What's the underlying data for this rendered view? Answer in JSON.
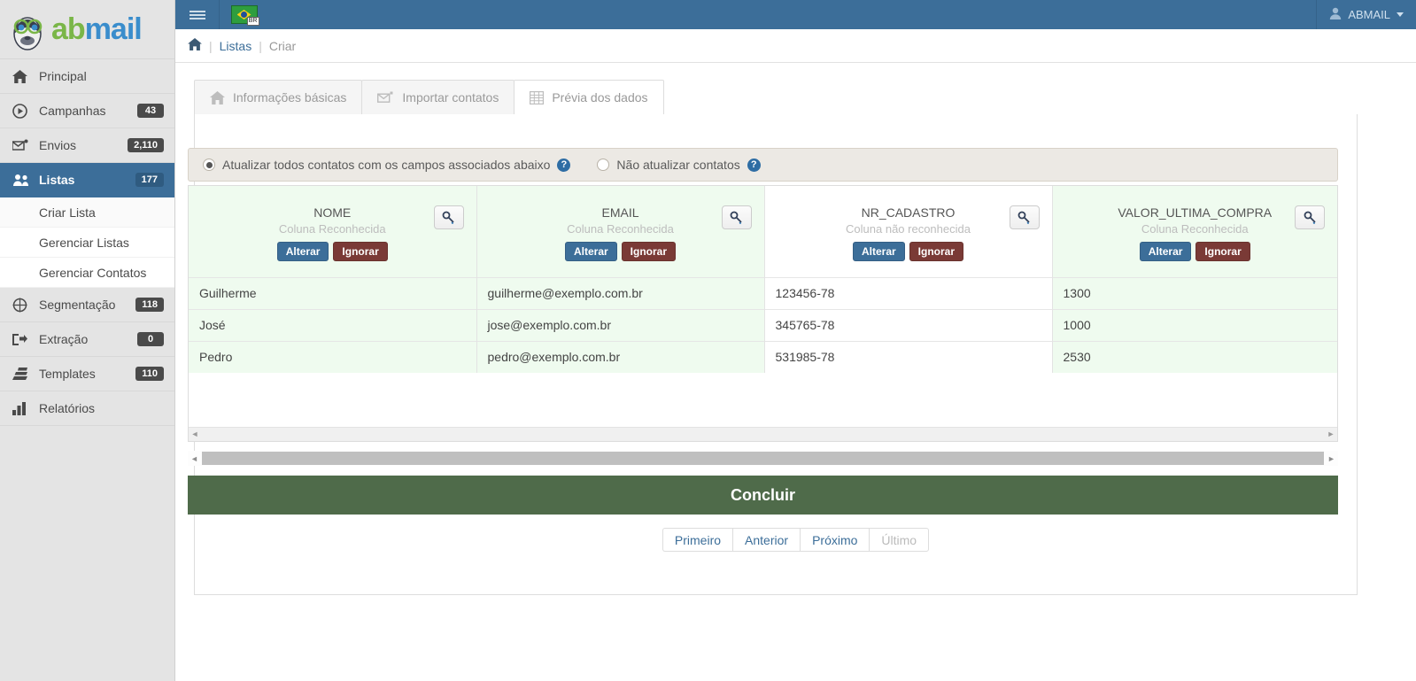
{
  "brand": {
    "name_part1": "ab",
    "name_part2": "mail",
    "color_green": "#7ab648",
    "color_blue": "#3a8dcc"
  },
  "topbar": {
    "menu_toggle": "hamburger-menu",
    "language": "BR",
    "user_label": "ABMAIL"
  },
  "breadcrumb": {
    "home": "home-icon",
    "items": [
      {
        "label": "Listas",
        "current": false
      },
      {
        "label": "Criar",
        "current": true
      }
    ]
  },
  "sidebar": {
    "items": [
      {
        "label": "Principal",
        "badge": "",
        "icon": "home-icon",
        "active": false
      },
      {
        "label": "Campanhas",
        "badge": "43",
        "icon": "play-circle-icon",
        "active": false
      },
      {
        "label": "Envios",
        "badge": "2,110",
        "icon": "envelope-send-icon",
        "active": false
      },
      {
        "label": "Listas",
        "badge": "177",
        "icon": "users-icon",
        "active": true
      },
      {
        "label": "Segmentação",
        "badge": "118",
        "icon": "target-icon",
        "active": false
      },
      {
        "label": "Extração",
        "badge": "0",
        "icon": "export-icon",
        "active": false
      },
      {
        "label": "Templates",
        "badge": "110",
        "icon": "layers-icon",
        "active": false
      },
      {
        "label": "Relatórios",
        "badge": "",
        "icon": "bar-chart-icon",
        "active": false
      }
    ],
    "sub_items": [
      {
        "label": "Criar Lista",
        "selected": true
      },
      {
        "label": "Gerenciar Listas",
        "selected": false
      },
      {
        "label": "Gerenciar Contatos",
        "selected": false
      }
    ]
  },
  "tabs": [
    {
      "label": "Informações básicas",
      "icon": "home-icon",
      "active": false
    },
    {
      "label": "Importar contatos",
      "icon": "envelope-import-icon",
      "active": false
    },
    {
      "label": "Prévia dos dados",
      "icon": "table-grid-icon",
      "active": true
    }
  ],
  "options": {
    "update_all": {
      "label": "Atualizar todos contatos com os campos associados abaixo",
      "selected": true,
      "help": "?"
    },
    "no_update": {
      "label": "Não atualizar contatos",
      "selected": false,
      "help": "?"
    }
  },
  "grid": {
    "columns": [
      {
        "name": "NOME",
        "status": "Coluna Reconhecida",
        "recognized": true,
        "alterar": "Alterar",
        "ignorar": "Ignorar",
        "key_icon": "key-icon"
      },
      {
        "name": "EMAIL",
        "status": "Coluna Reconhecida",
        "recognized": true,
        "alterar": "Alterar",
        "ignorar": "Ignorar",
        "key_icon": "key-icon"
      },
      {
        "name": "NR_CADASTRO",
        "status": "Coluna não reconhecida",
        "recognized": false,
        "alterar": "Alterar",
        "ignorar": "Ignorar",
        "key_icon": "key-icon"
      },
      {
        "name": "VALOR_ULTIMA_COMPRA",
        "status": "Coluna Reconhecida",
        "recognized": true,
        "alterar": "Alterar",
        "ignorar": "Ignorar",
        "key_icon": "key-icon"
      }
    ],
    "rows": [
      [
        "Guilherme",
        "guilherme@exemplo.com.br",
        "123456-78",
        "1300"
      ],
      [
        "José",
        "jose@exemplo.com.br",
        "345765-78",
        "1000"
      ],
      [
        "Pedro",
        "pedro@exemplo.com.br",
        "531985-78",
        "2530"
      ]
    ]
  },
  "submit": {
    "label": "Concluir",
    "color": "#4f6b4a"
  },
  "pagination": [
    {
      "label": "Primeiro",
      "disabled": false
    },
    {
      "label": "Anterior",
      "disabled": false
    },
    {
      "label": "Próximo",
      "disabled": false
    },
    {
      "label": "Último",
      "disabled": true
    }
  ],
  "scroll": {
    "left_arrow": "◄",
    "right_arrow": "►"
  }
}
